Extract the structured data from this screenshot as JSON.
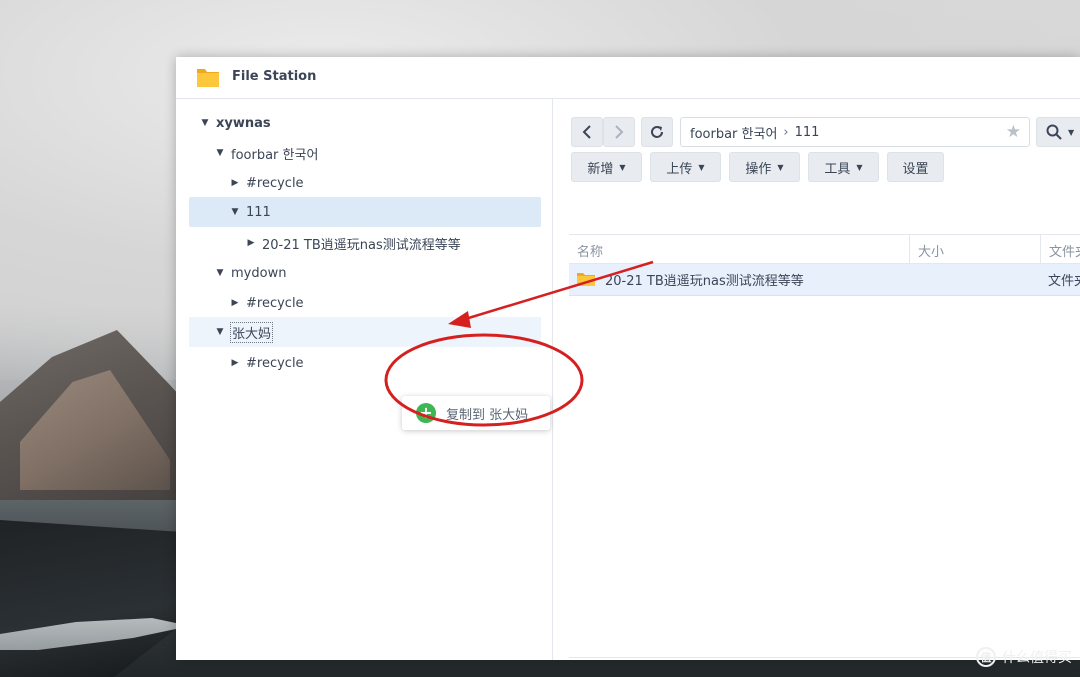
{
  "window": {
    "title": "File Station",
    "icon": "folder-icon"
  },
  "tree": {
    "nodes": [
      {
        "label": "xywnas",
        "expanded": true,
        "root": true
      },
      {
        "label": "foorbar 한국어",
        "expanded": true
      },
      {
        "label": "#recycle",
        "expanded": false
      },
      {
        "label": "111",
        "expanded": true,
        "selected": true
      },
      {
        "label": "20-21 TB逍遥玩nas测试流程等等",
        "expanded": false
      },
      {
        "label": "mydown",
        "expanded": true
      },
      {
        "label": "#recycle",
        "expanded": false
      },
      {
        "label": "张大妈",
        "expanded": true,
        "drop_target": true
      },
      {
        "label": "#recycle",
        "expanded": false
      }
    ]
  },
  "drag_tooltip": {
    "label": "复制到 张大妈",
    "icon": "plus-circle-icon",
    "color": "#3fb654"
  },
  "toolbar": {
    "path": {
      "segments": [
        "foorbar 한국어",
        "111"
      ],
      "separator": "›"
    },
    "buttons": [
      "新增",
      "上传",
      "操作",
      "工具",
      "设置"
    ]
  },
  "grid": {
    "columns": [
      "名称",
      "大小",
      "文件夹"
    ],
    "rows": [
      {
        "name": "20-21 TB逍遥玩nas测试流程等等",
        "size": "",
        "type": "文件夹"
      }
    ]
  },
  "watermark": {
    "text": "什么值得买",
    "logo": "值"
  },
  "colors": {
    "selection": "#dce9f7",
    "row_selected": "#e8f1fb",
    "annotation": "#d62020",
    "folder": "#f5b82e"
  }
}
